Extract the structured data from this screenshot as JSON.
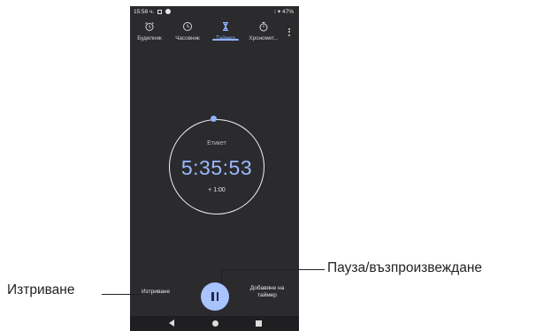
{
  "status_bar": {
    "time": "15:58 ч.",
    "right": "⁝ ▾ 47%"
  },
  "tabs": [
    {
      "label": "Будилник",
      "icon": "alarm-icon"
    },
    {
      "label": "Часовник",
      "icon": "clock-icon"
    },
    {
      "label": "Таймер",
      "icon": "hourglass-icon",
      "active": true
    },
    {
      "label": "Хрономет...",
      "icon": "stopwatch-icon"
    }
  ],
  "timer": {
    "label": "Етикет",
    "time": "5:35:53",
    "add_minute": "+ 1:00"
  },
  "controls": {
    "delete": "Изтриване",
    "add_timer_line1": "Добавяне на",
    "add_timer_line2": "таймер"
  },
  "callouts": {
    "left": "Изтриване",
    "right": "Пауза/възпроизвеждане"
  },
  "colors": {
    "accent": "#8fb3ff",
    "background": "#2b2b2e",
    "pause_button": "#a9c3ff"
  }
}
